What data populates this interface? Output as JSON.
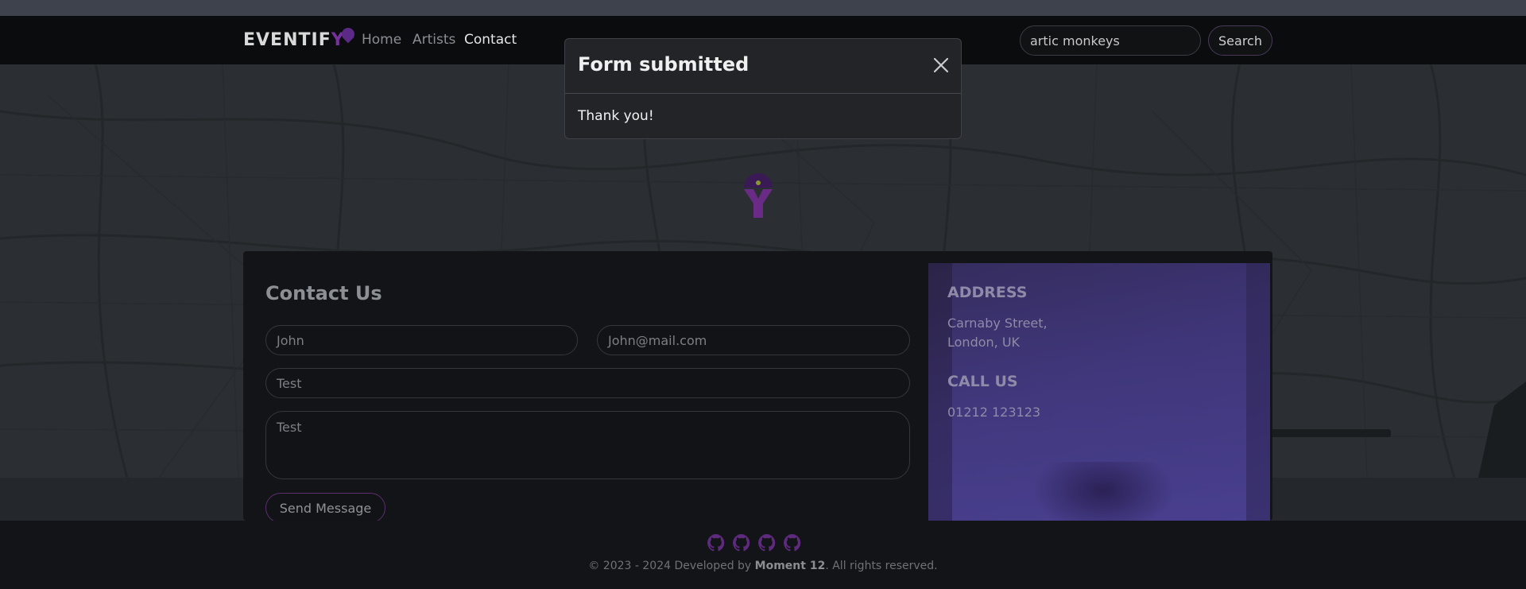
{
  "navbar": {
    "logo_text_prefix": "EVENTIF",
    "logo_text_y": "Y",
    "links": [
      {
        "label": "Home",
        "active": false
      },
      {
        "label": "Artists",
        "active": false
      },
      {
        "label": "Contact",
        "active": true
      }
    ],
    "search": {
      "value": "artic monkeys",
      "button_label": "Search"
    }
  },
  "modal": {
    "title": "Form submitted",
    "body": "Thank you!",
    "close_icon": "close-icon"
  },
  "contact": {
    "title": "Contact Us",
    "name_value": "John",
    "email_value": "John@mail.com",
    "subject_value": "Test",
    "message_value": "Test",
    "send_label": "Send Message"
  },
  "info": {
    "address_heading": "ADDRESS",
    "address_line1": "Carnaby Street,",
    "address_line2": "London, UK",
    "call_heading": "CALL US",
    "phone": "01212 123123"
  },
  "footer": {
    "icons": [
      "github-icon",
      "github-icon",
      "github-icon",
      "github-icon"
    ],
    "copyright_prefix": "© 2023 - 2024 Developed by ",
    "copyright_brand": "Moment 12",
    "copyright_suffix": ". All rights reserved."
  },
  "colors": {
    "accent": "#7a2f9e",
    "navbar_bg": "#0b0c0d",
    "map_bg": "#2b2f33",
    "modal_bg": "#222428"
  }
}
